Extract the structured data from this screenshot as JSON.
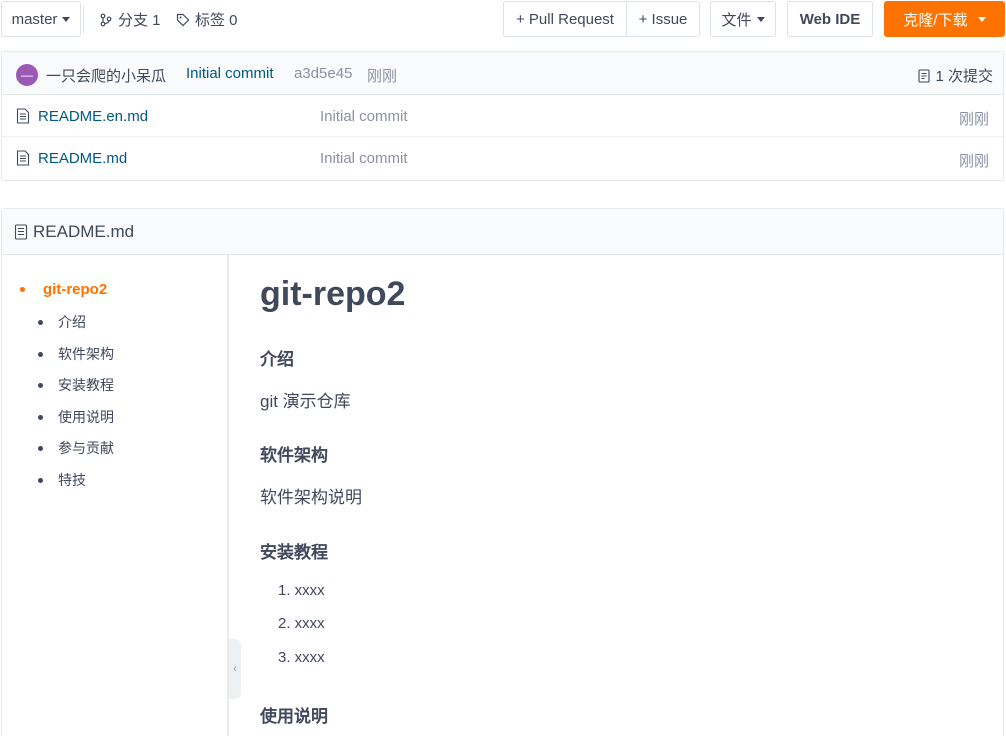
{
  "toolbar": {
    "branch": "master",
    "branches_label": "分支 1",
    "tags_label": "标签 0",
    "pull_request": "+ Pull Request",
    "issue": "+ Issue",
    "file_menu": "文件",
    "web_ide": "Web IDE",
    "clone": "克隆/下载"
  },
  "commit": {
    "avatar_letter": "—",
    "author": "一只会爬的小呆瓜",
    "message": "Initial commit",
    "sha": "a3d5e45",
    "time": "刚刚",
    "count": "1 次提交"
  },
  "files": [
    {
      "name": "README.en.md",
      "commit": "Initial commit",
      "time": "刚刚"
    },
    {
      "name": "README.md",
      "commit": "Initial commit",
      "time": "刚刚"
    }
  ],
  "readme": {
    "title": "README.md",
    "toc": {
      "main": "git-repo2",
      "items": [
        "介绍",
        "软件架构",
        "安装教程",
        "使用说明",
        "参与贡献",
        "特技"
      ]
    },
    "content": {
      "h1": "git-repo2",
      "intro_heading": "介绍",
      "intro_text": "git 演示仓库",
      "arch_heading": "软件架构",
      "arch_text": "软件架构说明",
      "install_heading": "安装教程",
      "install_steps": [
        "1. xxxx",
        "2. xxxx",
        "3. xxxx"
      ],
      "usage_heading": "使用说明"
    }
  },
  "colors": {
    "accent": "#fe7300",
    "link": "#005980",
    "muted": "#8c92a4",
    "text": "#40485b"
  }
}
